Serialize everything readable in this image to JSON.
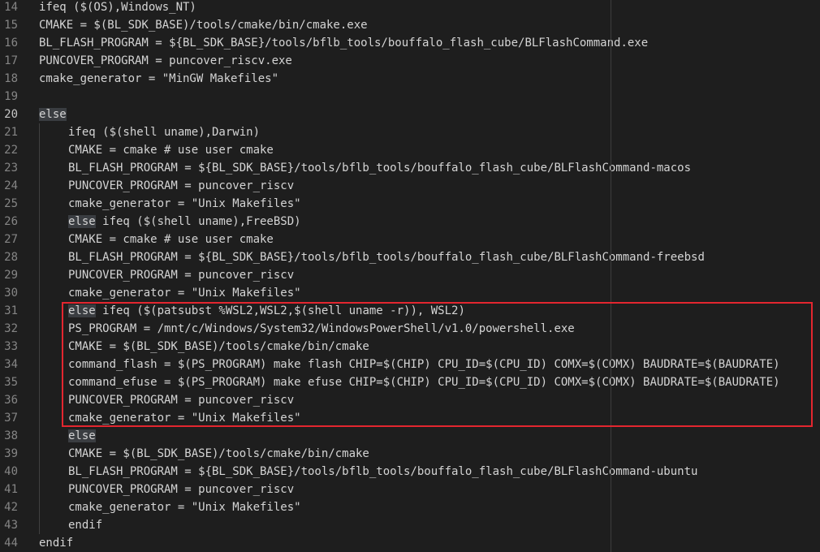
{
  "editor": {
    "language": "makefile",
    "current_line": 20,
    "highlight_box_color": "#e3262f",
    "highlight_box_lines": [
      31,
      37
    ],
    "lines": [
      {
        "n": "14",
        "indent": 0,
        "text": "ifeq ($(OS),Windows_NT)"
      },
      {
        "n": "15",
        "indent": 0,
        "text": "CMAKE = $(BL_SDK_BASE)/tools/cmake/bin/cmake.exe"
      },
      {
        "n": "16",
        "indent": 0,
        "text": "BL_FLASH_PROGRAM = ${BL_SDK_BASE}/tools/bflb_tools/bouffalo_flash_cube/BLFlashCommand.exe"
      },
      {
        "n": "17",
        "indent": 0,
        "text": "PUNCOVER_PROGRAM = puncover_riscv.exe"
      },
      {
        "n": "18",
        "indent": 0,
        "text": "cmake_generator = \"MinGW Makefiles\""
      },
      {
        "n": "19",
        "indent": 0,
        "text": ""
      },
      {
        "n": "20",
        "indent": 0,
        "hl": "else",
        "text": ""
      },
      {
        "n": "21",
        "indent": 1,
        "text": "ifeq ($(shell uname),Darwin)"
      },
      {
        "n": "22",
        "indent": 1,
        "text": "CMAKE = cmake # use user cmake"
      },
      {
        "n": "23",
        "indent": 1,
        "text": "BL_FLASH_PROGRAM = ${BL_SDK_BASE}/tools/bflb_tools/bouffalo_flash_cube/BLFlashCommand-macos"
      },
      {
        "n": "24",
        "indent": 1,
        "text": "PUNCOVER_PROGRAM = puncover_riscv"
      },
      {
        "n": "25",
        "indent": 1,
        "text": "cmake_generator = \"Unix Makefiles\""
      },
      {
        "n": "26",
        "indent": 1,
        "hl": "else",
        "text": " ifeq ($(shell uname),FreeBSD)"
      },
      {
        "n": "27",
        "indent": 1,
        "text": "CMAKE = cmake # use user cmake"
      },
      {
        "n": "28",
        "indent": 1,
        "text": "BL_FLASH_PROGRAM = ${BL_SDK_BASE}/tools/bflb_tools/bouffalo_flash_cube/BLFlashCommand-freebsd"
      },
      {
        "n": "29",
        "indent": 1,
        "text": "PUNCOVER_PROGRAM = puncover_riscv"
      },
      {
        "n": "30",
        "indent": 1,
        "text": "cmake_generator = \"Unix Makefiles\""
      },
      {
        "n": "31",
        "indent": 1,
        "hl": "else",
        "text": " ifeq ($(patsubst %WSL2,WSL2,$(shell uname -r)), WSL2)"
      },
      {
        "n": "32",
        "indent": 1,
        "text": "PS_PROGRAM = /mnt/c/Windows/System32/WindowsPowerShell/v1.0/powershell.exe"
      },
      {
        "n": "33",
        "indent": 1,
        "text": "CMAKE = $(BL_SDK_BASE)/tools/cmake/bin/cmake"
      },
      {
        "n": "34",
        "indent": 1,
        "text": "command_flash = $(PS_PROGRAM) make flash CHIP=$(CHIP) CPU_ID=$(CPU_ID) COMX=$(COMX) BAUDRATE=$(BAUDRATE)"
      },
      {
        "n": "35",
        "indent": 1,
        "text": "command_efuse = $(PS_PROGRAM) make efuse CHIP=$(CHIP) CPU_ID=$(CPU_ID) COMX=$(COMX) BAUDRATE=$(BAUDRATE)"
      },
      {
        "n": "36",
        "indent": 1,
        "text": "PUNCOVER_PROGRAM = puncover_riscv"
      },
      {
        "n": "37",
        "indent": 1,
        "text": "cmake_generator = \"Unix Makefiles\""
      },
      {
        "n": "38",
        "indent": 1,
        "hl": "else",
        "text": ""
      },
      {
        "n": "39",
        "indent": 1,
        "text": "CMAKE = $(BL_SDK_BASE)/tools/cmake/bin/cmake"
      },
      {
        "n": "40",
        "indent": 1,
        "text": "BL_FLASH_PROGRAM = ${BL_SDK_BASE}/tools/bflb_tools/bouffalo_flash_cube/BLFlashCommand-ubuntu"
      },
      {
        "n": "41",
        "indent": 1,
        "text": "PUNCOVER_PROGRAM = puncover_riscv"
      },
      {
        "n": "42",
        "indent": 1,
        "text": "cmake_generator = \"Unix Makefiles\""
      },
      {
        "n": "43",
        "indent": 1,
        "text": "endif"
      },
      {
        "n": "44",
        "indent": 0,
        "text": "endif"
      }
    ]
  }
}
